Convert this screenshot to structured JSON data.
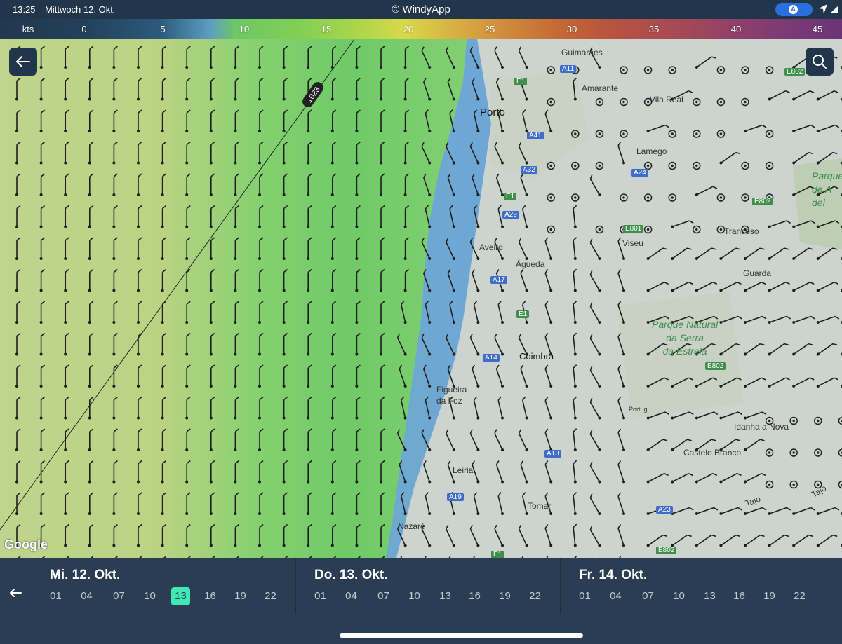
{
  "status_bar": {
    "time": "13:25",
    "date": "Mittwoch 12. Okt.",
    "title": "© WindyApp",
    "location_badge": "A"
  },
  "legend": {
    "unit": "kts",
    "ticks": [
      "0",
      "5",
      "10",
      "15",
      "20",
      "25",
      "30",
      "35",
      "40",
      "45"
    ]
  },
  "map": {
    "back_icon": "arrow-left-icon",
    "search_icon": "search-icon",
    "isobar_label": "1023",
    "attribution": "Google",
    "places": [
      "Guimarães",
      "Amarante",
      "Vila Real",
      "Porto",
      "Lamego",
      "Viseu",
      "Trancoso",
      "Aveiro",
      "Águeda",
      "Guarda",
      "Coimbra",
      "Figueira da Foz",
      "Idanha a Nova",
      "Castelo Branco",
      "Leiria",
      "Tomar",
      "Nazaré",
      "Portug",
      "Tajo",
      "Tajo"
    ],
    "park": [
      "Parque Natural",
      "da Serra",
      "da Estrela"
    ],
    "park_edge": [
      "Parque",
      "de A",
      "del"
    ],
    "roads": [
      "A11",
      "E1",
      "A41",
      "A32",
      "A24",
      "E1",
      "A29",
      "E801",
      "E802",
      "A17",
      "E1",
      "A14",
      "E802",
      "A13",
      "A19",
      "A23",
      "E802",
      "E1",
      "E802"
    ]
  },
  "timeline": {
    "back_icon": "arrow-left-icon",
    "days": [
      {
        "label": "Mi. 12. Okt.",
        "hours": [
          "01",
          "04",
          "07",
          "10",
          "13",
          "16",
          "19",
          "22"
        ],
        "selected": "13"
      },
      {
        "label": "Do. 13. Okt.",
        "hours": [
          "01",
          "04",
          "07",
          "10",
          "13",
          "16",
          "19",
          "22"
        ]
      },
      {
        "label": "Fr. 14. Okt.",
        "hours": [
          "01",
          "04",
          "07",
          "10",
          "13",
          "16",
          "19",
          "22"
        ]
      }
    ]
  },
  "colors": {
    "panel": "#2b3d52",
    "status_bar": "#22364b",
    "selected_hour": "#3fe8b5",
    "sea_blue": "#6ea7d8",
    "wind_green": "#72cc6a",
    "wind_yellow_green": "#c9d48a",
    "land": "#cfd6d2"
  }
}
